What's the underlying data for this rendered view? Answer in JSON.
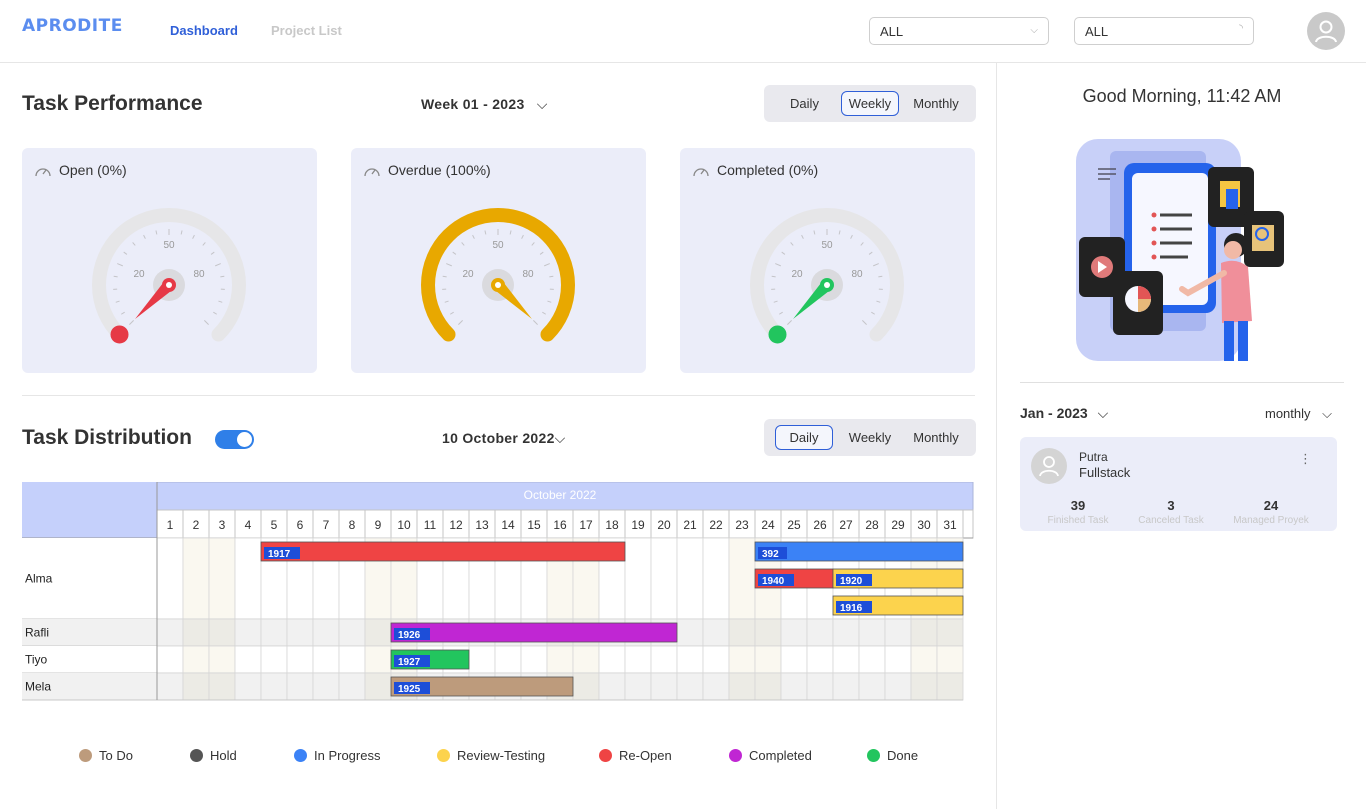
{
  "header": {
    "logo": "APRODITE",
    "nav": [
      {
        "label": "Dashboard",
        "active": true
      },
      {
        "label": "Project List",
        "active": false
      }
    ],
    "filter1": "ALL",
    "filter2": "ALL"
  },
  "performance": {
    "title": "Task Performance",
    "period": "Week 01 - 2023",
    "tabs": [
      "Daily",
      "Weekly",
      "Monthly"
    ],
    "active_tab": "Weekly",
    "gauges": [
      {
        "label": "Open (0%)",
        "value": 0,
        "color": "#e63946",
        "ticks": [
          "20",
          "50",
          "80"
        ]
      },
      {
        "label": "Overdue (100%)",
        "value": 100,
        "color": "#e8a800",
        "ticks": [
          "20",
          "50",
          "80"
        ]
      },
      {
        "label": "Completed (0%)",
        "value": 0,
        "color": "#22c55e",
        "ticks": [
          "20",
          "50",
          "80"
        ]
      }
    ]
  },
  "distribution": {
    "title": "Task Distribution",
    "date": "10 October 2022",
    "tabs": [
      "Daily",
      "Weekly",
      "Monthly"
    ],
    "active_tab": "Daily",
    "toggle_on": true,
    "month_label": "October 2022",
    "days": [
      "1",
      "2",
      "3",
      "4",
      "5",
      "6",
      "7",
      "8",
      "9",
      "10",
      "11",
      "12",
      "13",
      "14",
      "15",
      "16",
      "17",
      "18",
      "19",
      "20",
      "21",
      "22",
      "23",
      "24",
      "25",
      "26",
      "27",
      "28",
      "29",
      "30",
      "31"
    ],
    "rows": [
      {
        "name": "Alma",
        "lanes": 3
      },
      {
        "name": "Rafli",
        "lanes": 1
      },
      {
        "name": "Tiyo",
        "lanes": 1
      },
      {
        "name": "Mela",
        "lanes": 1
      }
    ],
    "tasks": [
      {
        "id": "1917",
        "row": 0,
        "lane": 0,
        "start": 5,
        "end": 18,
        "status": "Re-Open"
      },
      {
        "id": "392",
        "row": 0,
        "lane": 0,
        "start": 24,
        "end": 31,
        "status": "In Progress"
      },
      {
        "id": "1940",
        "row": 0,
        "lane": 1,
        "start": 24,
        "end": 26,
        "status": "Re-Open"
      },
      {
        "id": "1920",
        "row": 0,
        "lane": 1,
        "start": 27,
        "end": 31,
        "status": "Review-Testing"
      },
      {
        "id": "1916",
        "row": 0,
        "lane": 2,
        "start": 27,
        "end": 31,
        "status": "Review-Testing"
      },
      {
        "id": "1926",
        "row": 1,
        "lane": 0,
        "start": 10,
        "end": 20,
        "status": "Completed"
      },
      {
        "id": "1927",
        "row": 2,
        "lane": 0,
        "start": 10,
        "end": 12,
        "status": "Done"
      },
      {
        "id": "1925",
        "row": 3,
        "lane": 0,
        "start": 10,
        "end": 16,
        "status": "To Do"
      }
    ],
    "weekend_days": [
      1,
      2,
      8,
      9,
      15,
      16,
      22,
      23,
      29,
      30
    ],
    "legend": [
      {
        "label": "To Do",
        "color": "#bd9b7c"
      },
      {
        "label": "Hold",
        "color": "#555555"
      },
      {
        "label": "In Progress",
        "color": "#3b82f6"
      },
      {
        "label": "Review-Testing",
        "color": "#fcd34d"
      },
      {
        "label": "Re-Open",
        "color": "#ef4444"
      },
      {
        "label": "Completed",
        "color": "#c026d3"
      },
      {
        "label": "Done",
        "color": "#22c55e"
      }
    ]
  },
  "sidebar": {
    "greeting": "Good Morning, 11:42 AM",
    "month": "Jan - 2023",
    "period": "monthly",
    "user": {
      "name": "Putra",
      "role": "Fullstack",
      "stats": [
        {
          "value": "39",
          "label": "Finished Task"
        },
        {
          "value": "3",
          "label": "Canceled Task"
        },
        {
          "value": "24",
          "label": "Managed Proyek"
        }
      ]
    }
  }
}
